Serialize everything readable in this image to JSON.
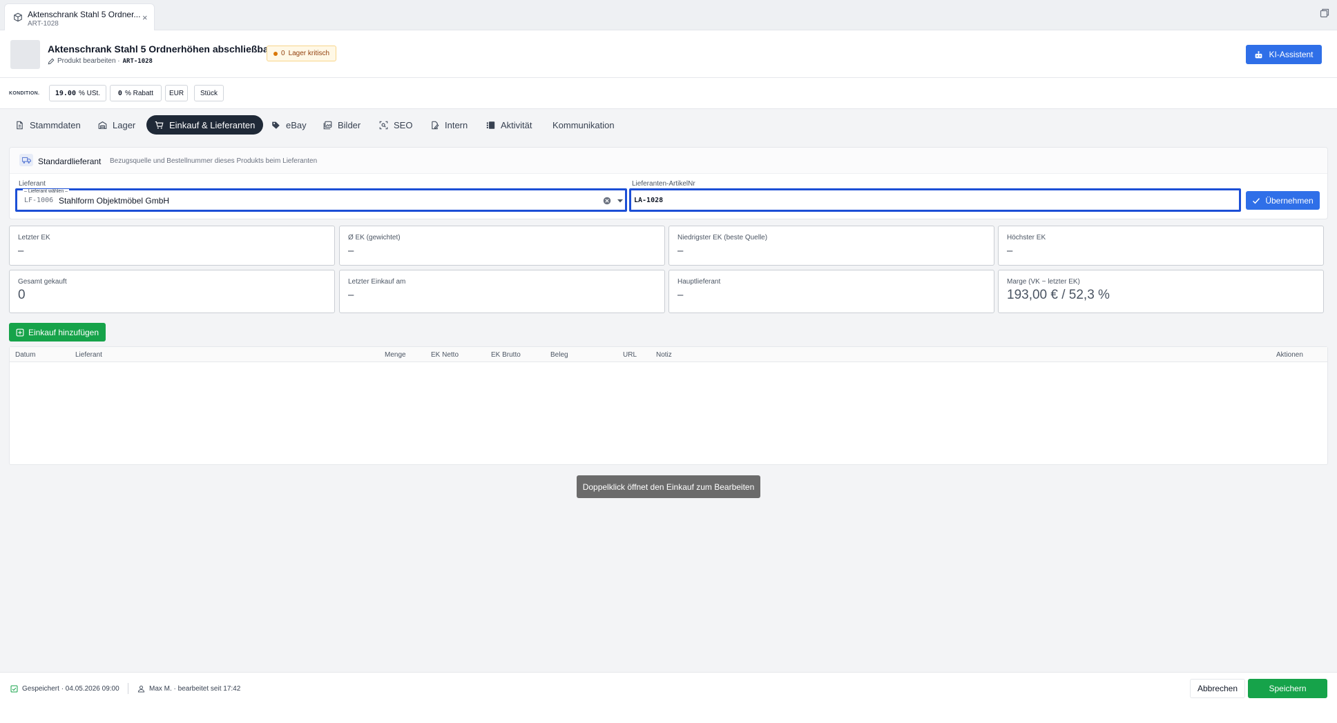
{
  "window": {
    "tab_title": "Aktenschrank Stahl 5 Ordner...",
    "tab_subtitle": "ART-1028"
  },
  "header": {
    "title": "Aktenschrank Stahl 5 Ordnerhöhen abschließbar",
    "edit_label": "Produkt bearbeiten ·",
    "article_code": "ART-1028",
    "badge_count": "0",
    "badge_label": "Lager kritisch",
    "ai_button": "KI-Assistent"
  },
  "conditions": {
    "label": "KONDITION.",
    "vat_value": "19.00",
    "vat_label": "% USt.",
    "discount_value": "0",
    "discount_label": "% Rabatt",
    "currency": "EUR",
    "unit": "Stück"
  },
  "tabs": [
    {
      "label": "Stammdaten",
      "icon": "document-icon"
    },
    {
      "label": "Lager",
      "icon": "warehouse-icon"
    },
    {
      "label": "Einkauf & Lieferanten",
      "icon": "cart-icon"
    },
    {
      "label": "eBay",
      "icon": "tag-icon"
    },
    {
      "label": "Bilder",
      "icon": "images-icon"
    },
    {
      "label": "SEO",
      "icon": "seo-icon"
    },
    {
      "label": "Intern",
      "icon": "edit-doc-icon"
    },
    {
      "label": "Aktivität",
      "icon": "activity-icon"
    },
    {
      "label": "Kommunikation",
      "icon": ""
    }
  ],
  "active_tab": "Einkauf & Lieferanten",
  "supplier": {
    "title": "Standardlieferant",
    "subtitle": "Bezugsquelle und Bestellnummer dieses Produkts beim Lieferanten",
    "supplier_label": "Lieferant",
    "select_hint": "– Lieferant wählen –",
    "supplier_code": "LF-1006",
    "supplier_name": "Stahlform Objektmöbel GmbH",
    "article_label": "Lieferanten-ArtikelNr",
    "article_value": "LA-1028",
    "apply_button": "Übernehmen"
  },
  "stats": [
    {
      "label": "Letzter EK",
      "value": "–"
    },
    {
      "label": "Ø EK (gewichtet)",
      "value": "–"
    },
    {
      "label": "Niedrigster EK (beste Quelle)",
      "value": "–"
    },
    {
      "label": "Höchster EK",
      "value": "–"
    },
    {
      "label": "Gesamt gekauft",
      "value": "0"
    },
    {
      "label": "Letzter Einkauf am",
      "value": "–"
    },
    {
      "label": "Hauptlieferant",
      "value": "–"
    },
    {
      "label": "Marge (VK − letzter EK)",
      "value": "193,00 € / 52,3 %"
    }
  ],
  "add_purchase_button": "Einkauf hinzufügen",
  "table": {
    "columns": [
      "Datum",
      "Lieferant",
      "Menge",
      "EK Netto",
      "EK Brutto",
      "Beleg",
      "URL",
      "Notiz",
      "Aktionen"
    ]
  },
  "tooltip": "Doppelklick öffnet den Einkauf zum Bearbeiten",
  "footer": {
    "saved": "Gespeichert · 04.05.2026 09:00",
    "user": "Max M. · bearbeitet seit 17:42",
    "cancel": "Abbrechen",
    "save": "Speichern"
  },
  "colors": {
    "primary": "#2f6fe8",
    "success": "#16a34a",
    "focus": "#1c4fd6",
    "active_tab": "#1f2937"
  }
}
